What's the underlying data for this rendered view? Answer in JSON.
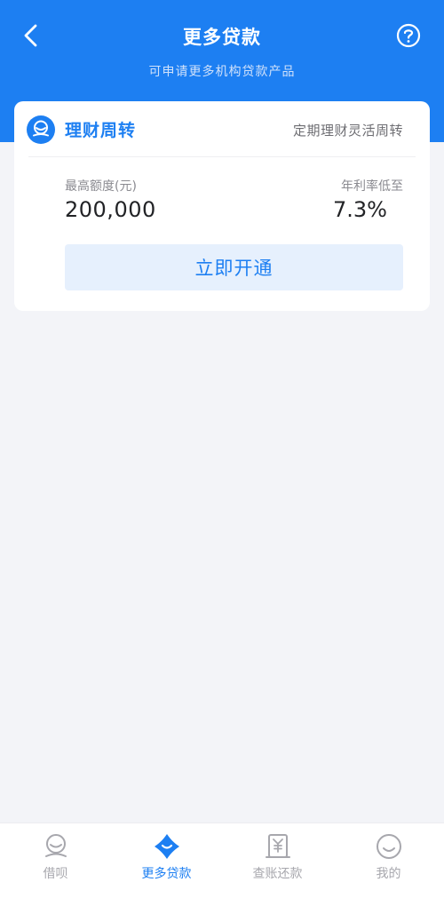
{
  "header": {
    "title": "更多贷款",
    "subtitle": "可申请更多机构贷款产品"
  },
  "product": {
    "name": "理财周转",
    "tag": "定期理财灵活周转",
    "max_amount_label": "最高额度(元)",
    "max_amount": "200,000",
    "rate_label": "年利率低至",
    "rate": "7.3%",
    "cta_label": "立即开通"
  },
  "tabbar": {
    "tabs": [
      {
        "label": "借呗",
        "icon": "jiebei-icon",
        "active": false
      },
      {
        "label": "更多贷款",
        "icon": "more-loans-icon",
        "active": true
      },
      {
        "label": "查账还款",
        "icon": "bill-repay-icon",
        "active": false
      },
      {
        "label": "我的",
        "icon": "smiley-icon",
        "active": false
      }
    ]
  },
  "colors": {
    "brand": "#1d7ff2",
    "background": "#f3f4f8",
    "cta_bg": "#e6f0fd",
    "inactive": "#a7a7ad"
  }
}
